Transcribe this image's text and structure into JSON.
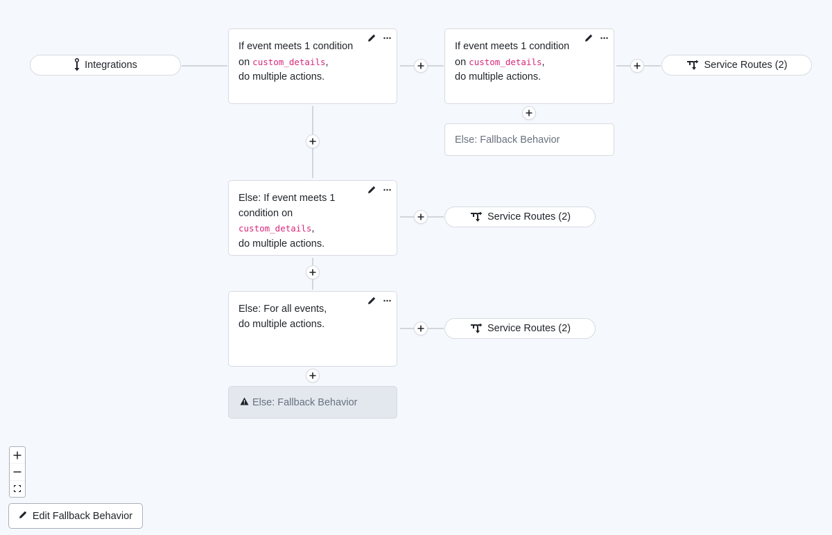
{
  "canvas": {
    "background": "#f5f8fc",
    "accent_code_color": "#d6277b"
  },
  "nodes": {
    "integrations": {
      "label": "Integrations",
      "icon": "integration-icon"
    },
    "rule1": {
      "prefix": "If event meets 1 condition",
      "on": "on ",
      "field": "custom_details",
      "comma": ",",
      "suffix": "do multiple actions."
    },
    "nested_rule": {
      "prefix": "If event meets 1 condition",
      "on": "on ",
      "field": "custom_details",
      "comma": ",",
      "suffix": "do multiple actions."
    },
    "nested_fallback": {
      "label": "Else: Fallback Behavior"
    },
    "rule2": {
      "prefix_line1": "Else: If event meets 1",
      "prefix_line2": "condition on",
      "field": "custom_details",
      "comma": ",",
      "suffix": "do multiple actions."
    },
    "rule3": {
      "line1": "Else: For all events,",
      "line2": "do multiple actions."
    },
    "fallback": {
      "label": "Else: Fallback Behavior",
      "icon": "warning-icon"
    },
    "service_routes": [
      {
        "label": "Service Routes (2)"
      },
      {
        "label": "Service Routes (2)"
      },
      {
        "label": "Service Routes (2)"
      }
    ]
  },
  "card_actions": {
    "edit_icon": "pencil-icon",
    "more_icon": "ellipsis-icon"
  },
  "controls": {
    "zoom_in": "+",
    "zoom_out": "−",
    "fit_icon": "fit-view-icon",
    "edit_fallback_label": "Edit Fallback Behavior"
  }
}
